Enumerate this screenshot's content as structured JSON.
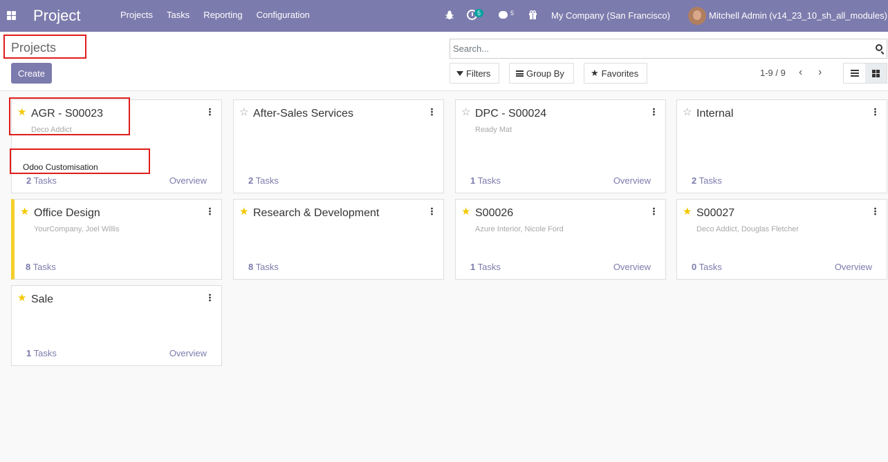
{
  "navbar": {
    "brand": "Project",
    "menu": [
      "Projects",
      "Tasks",
      "Reporting",
      "Configuration"
    ],
    "activity_count": "5",
    "messages_count": "5",
    "company": "My Company (San Francisco)",
    "user": "Mitchell Admin (v14_23_10_sh_all_modules)",
    "color": "#7c7bad"
  },
  "control": {
    "breadcrumb": "Projects",
    "create_label": "Create",
    "search_placeholder": "Search...",
    "filters_label": "Filters",
    "groupby_label": "Group By",
    "favorites_label": "Favorites",
    "pager": "1-9 / 9"
  },
  "cards": [
    {
      "title": "AGR - S00023",
      "subtitle": "Deco Addict",
      "extra": "Odoo Customisation",
      "tasks_count": "2",
      "tasks_label": "Tasks",
      "overview": "Overview",
      "favorite": true
    },
    {
      "title": "After-Sales Services",
      "subtitle": "",
      "tasks_count": "2",
      "tasks_label": "Tasks",
      "overview": "",
      "favorite": false
    },
    {
      "title": "DPC - S00024",
      "subtitle": "Ready Mat",
      "tasks_count": "1",
      "tasks_label": "Tasks",
      "overview": "Overview",
      "favorite": false
    },
    {
      "title": "Internal",
      "subtitle": "",
      "tasks_count": "2",
      "tasks_label": "Tasks",
      "overview": "",
      "favorite": false
    },
    {
      "title": "Office Design",
      "subtitle": "YourCompany, Joel Willis",
      "tasks_count": "8",
      "tasks_label": "Tasks",
      "overview": "",
      "favorite": true
    },
    {
      "title": "Research & Development",
      "subtitle": "",
      "tasks_count": "8",
      "tasks_label": "Tasks",
      "overview": "",
      "favorite": true
    },
    {
      "title": "S00026",
      "subtitle": "Azure Interior, Nicole Ford",
      "tasks_count": "1",
      "tasks_label": "Tasks",
      "overview": "Overview",
      "favorite": true
    },
    {
      "title": "S00027",
      "subtitle": "Deco Addict, Douglas Fletcher",
      "tasks_count": "0",
      "tasks_label": "Tasks",
      "overview": "Overview",
      "favorite": true
    },
    {
      "title": "Sale",
      "subtitle": "",
      "tasks_count": "1",
      "tasks_label": "Tasks",
      "overview": "Overview",
      "favorite": true
    }
  ]
}
